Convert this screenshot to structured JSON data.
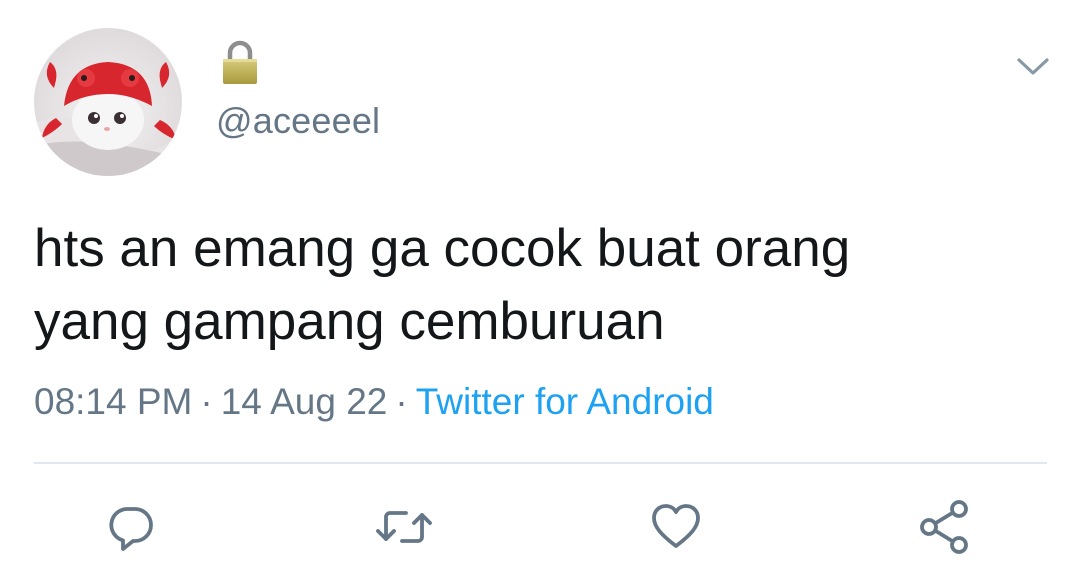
{
  "profile": {
    "handle": "@aceeeel",
    "protected_icon": "lock-icon",
    "avatar": "avatar-image"
  },
  "header": {
    "menu_icon": "chevron-down-icon"
  },
  "tweet": {
    "line1": "hts an emang ga cocok buat orang",
    "line2": "yang gampang cemburuan"
  },
  "meta": {
    "time": "08:14 PM",
    "separator": "·",
    "date": "14 Aug 22",
    "source": "Twitter for Android"
  },
  "actions": [
    {
      "icon": "reply-icon"
    },
    {
      "icon": "retweet-icon"
    },
    {
      "icon": "like-icon"
    },
    {
      "icon": "share-icon"
    }
  ],
  "colors": {
    "text": "#14171a",
    "secondary": "#657786",
    "link": "#1da1f2",
    "divider": "#e1e8ed"
  }
}
